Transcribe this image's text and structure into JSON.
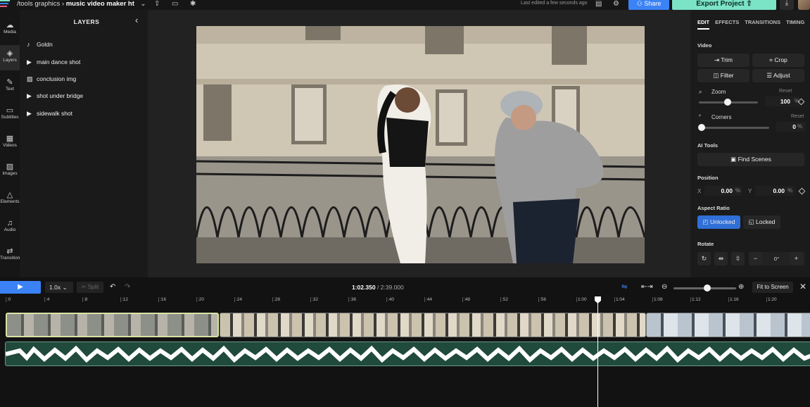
{
  "topbar": {
    "breadcrumb_parent": "/tools graphics",
    "breadcrumb_sep": "›",
    "project_name": "music video maker ht",
    "last_edited": "Last edited a few seconds ago",
    "share_label": "Share",
    "export_label": "Export Project",
    "brand_colors": {
      "share": "#3b82f6",
      "export": "#7be3c6"
    }
  },
  "rail": {
    "items": [
      {
        "label": "Media",
        "icon": "upload-cloud-icon"
      },
      {
        "label": "Layers",
        "icon": "layers-icon"
      },
      {
        "label": "Text",
        "icon": "text-icon"
      },
      {
        "label": "Subtitles",
        "icon": "subtitles-icon"
      },
      {
        "label": "Videos",
        "icon": "film-icon"
      },
      {
        "label": "Images",
        "icon": "image-icon"
      },
      {
        "label": "Elements",
        "icon": "shapes-icon"
      },
      {
        "label": "Audio",
        "icon": "music-note-icon"
      },
      {
        "label": "Transitions",
        "icon": "transitions-icon"
      }
    ]
  },
  "layers": {
    "title": "LAYERS",
    "items": [
      {
        "label": "Goldn",
        "icon": "music-note-icon"
      },
      {
        "label": "main dance shot",
        "icon": "play-icon"
      },
      {
        "label": "conclusion img",
        "icon": "image-icon"
      },
      {
        "label": "shot under bridge",
        "icon": "play-icon"
      },
      {
        "label": "sidewalk shot",
        "icon": "play-icon"
      }
    ]
  },
  "inspector": {
    "tabs": [
      "EDIT",
      "EFFECTS",
      "TRANSITIONS",
      "TIMING"
    ],
    "video_label": "Video",
    "trim": "Trim",
    "crop": "Crop",
    "filter": "Filter",
    "adjust": "Adjust",
    "zoom_label": "Zoom",
    "zoom_value": "100",
    "zoom_level": 0.42,
    "reset": "Reset",
    "corners_label": "Corners",
    "corners_value": "0",
    "ai_label": "AI Tools",
    "find_scenes": "Find Scenes",
    "position_label": "Position",
    "pos_x_label": "X",
    "pos_x": "0.00",
    "pos_y_label": "Y",
    "pos_y": "0.00",
    "pct": "%",
    "aspect_label": "Aspect Ratio",
    "unlocked": "Unlocked",
    "locked": "Locked",
    "rotate_label": "Rotate",
    "rotate_value": "0°",
    "minus": "−",
    "plus": "+"
  },
  "timeline": {
    "play_icon": "▶",
    "speed": "1.0x",
    "split": "Split",
    "current_time": "1:02.350",
    "total_time": "/ 2:39.000",
    "fit_label": "Fit to Screen",
    "ticks": [
      ":0",
      ":4",
      ":8",
      ":12",
      ":16",
      ":20",
      ":24",
      ":28",
      ":32",
      ":36",
      ":40",
      ":44",
      ":48",
      ":52",
      ":56",
      "1:00",
      "1:04",
      "1:08",
      "1:12",
      "1:16",
      "1:20"
    ]
  }
}
